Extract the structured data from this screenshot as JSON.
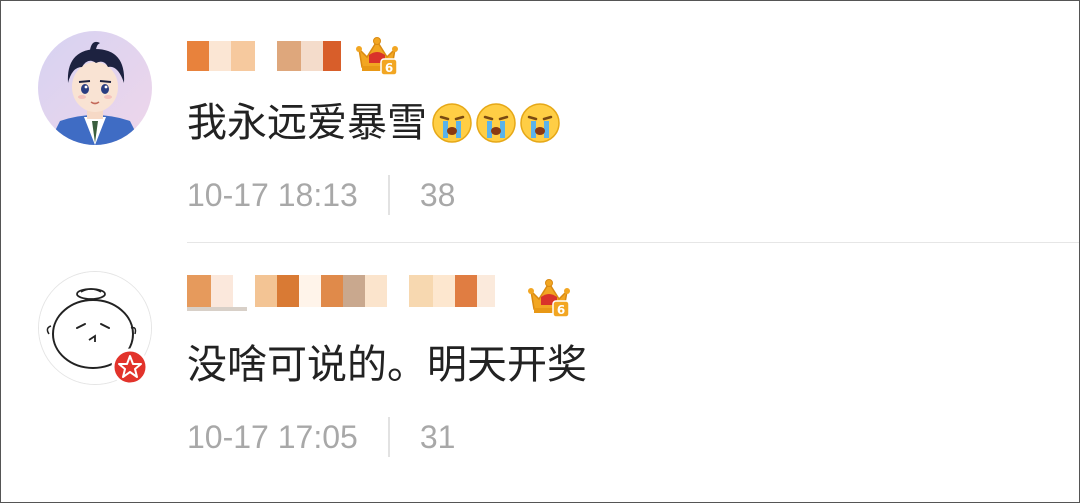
{
  "colors": {
    "text_primary": "#222222",
    "text_meta": "#a8a8a8",
    "divider": "#e2e2e2",
    "vip_gold": "#f2a622",
    "verified_red": "#e2332b"
  },
  "comments": [
    {
      "username": "",
      "username_obscured": true,
      "vip_level": "6",
      "vip_icon": "crown-vip-icon",
      "text": "我永远爱暴雪",
      "emojis": [
        "crying-face-emoji",
        "crying-face-emoji",
        "crying-face-emoji"
      ],
      "timestamp": "10-17 18:13",
      "likes": "38",
      "avatar": "anime-boy-avatar"
    },
    {
      "username": "",
      "username_obscured": true,
      "vip_level": "6",
      "vip_icon": "crown-vip-icon",
      "verified_icon": "star-verified-icon",
      "text": "没啥可说的。明天开奖",
      "emojis": [],
      "timestamp": "10-17 17:05",
      "likes": "31",
      "avatar": "doodle-face-avatar"
    }
  ]
}
